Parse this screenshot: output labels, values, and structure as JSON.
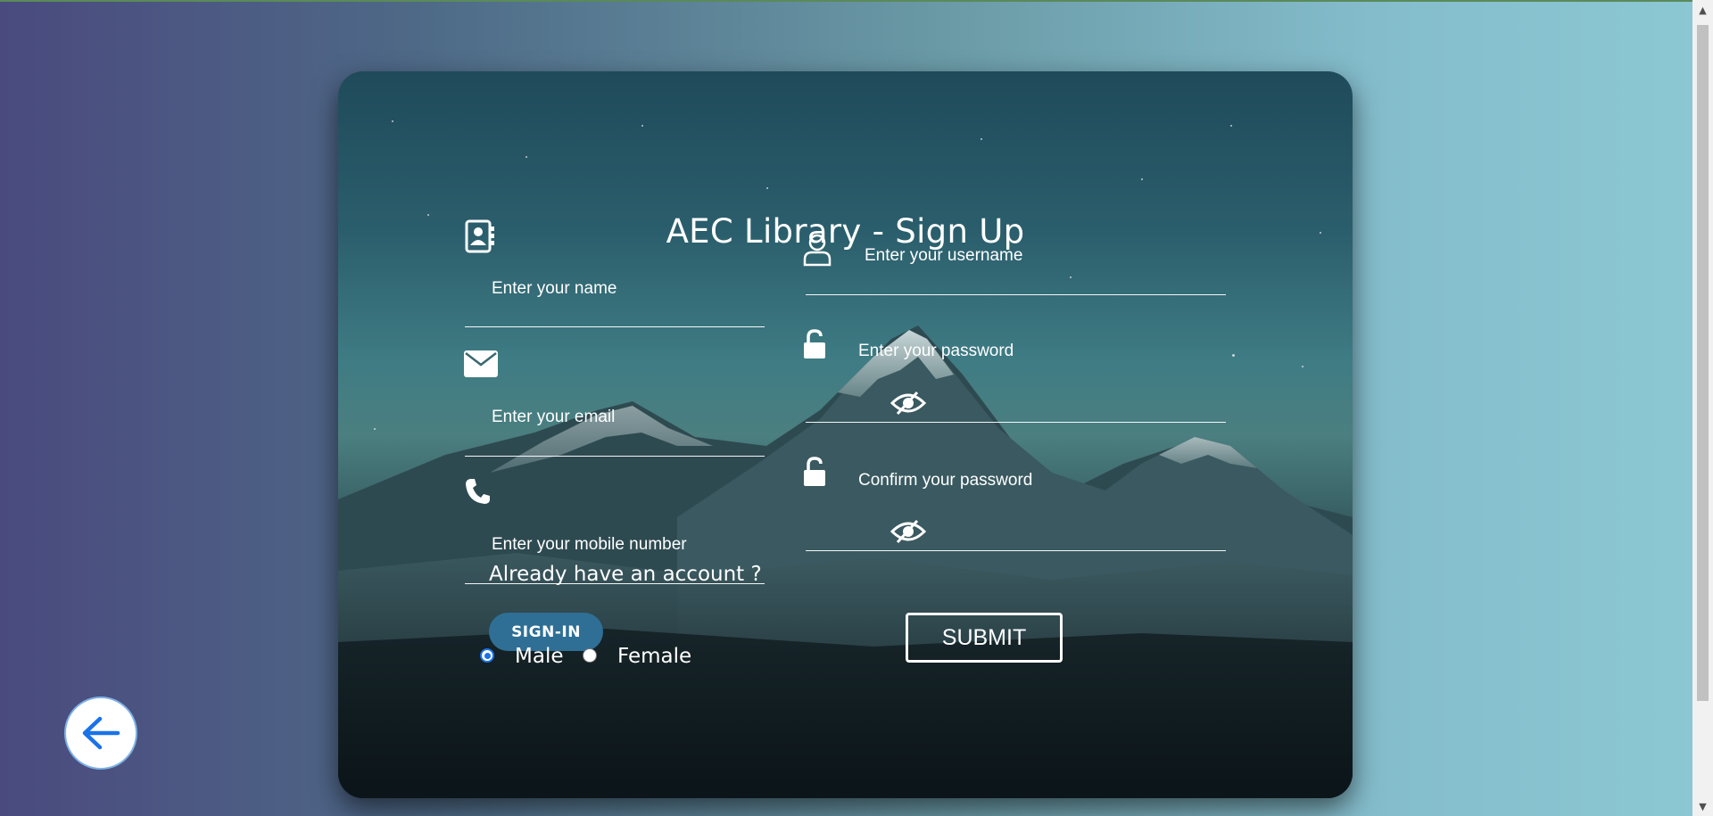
{
  "page": {
    "title": "AEC Library - Sign Up"
  },
  "form": {
    "name_placeholder": "Enter your name",
    "email_placeholder": "Enter your email",
    "mobile_placeholder": "Enter your mobile number",
    "username_placeholder": "Enter your username",
    "password_placeholder": "Enter your password",
    "confirm_password_placeholder": "Confirm your password",
    "gender_options": [
      {
        "label": "Male",
        "selected": true
      },
      {
        "label": "Female",
        "selected": false
      }
    ],
    "submit_label": "SUBMIT"
  },
  "signin": {
    "prompt": "Already have an account ?",
    "button_label": "SIGN-IN"
  },
  "icons": {
    "name": "address-book-icon",
    "email": "envelope-icon",
    "mobile": "phone-icon",
    "username": "user-icon",
    "password": "unlock-icon",
    "confirm_password": "unlock-icon",
    "toggle_password": "eye-slash-icon",
    "back": "arrow-left-icon"
  },
  "colors": {
    "signin_button": "#2f6f95",
    "back_arrow": "#1a73e8"
  }
}
